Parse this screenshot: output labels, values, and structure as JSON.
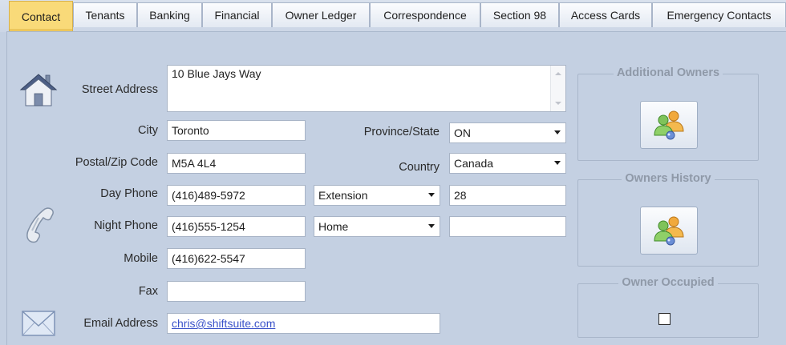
{
  "tabs": [
    {
      "label": "Contact",
      "active": true
    },
    {
      "label": "Tenants",
      "active": false
    },
    {
      "label": "Banking",
      "active": false
    },
    {
      "label": "Financial",
      "active": false
    },
    {
      "label": "Owner Ledger",
      "active": false
    },
    {
      "label": "Correspondence",
      "active": false
    },
    {
      "label": "Section 98",
      "active": false
    },
    {
      "label": "Access Cards",
      "active": false
    },
    {
      "label": "Emergency Contacts",
      "active": false
    }
  ],
  "form": {
    "street_address": {
      "label": "Street Address",
      "value": "10 Blue Jays Way"
    },
    "city": {
      "label": "City",
      "value": "Toronto"
    },
    "province": {
      "label": "Province/State",
      "value": "ON"
    },
    "postal_code": {
      "label": "Postal/Zip Code",
      "value": "M5A 4L4"
    },
    "country": {
      "label": "Country",
      "value": "Canada"
    },
    "day_phone": {
      "label": "Day Phone",
      "value": "(416)489-5972",
      "type": "Extension",
      "extra": "28"
    },
    "night_phone": {
      "label": "Night Phone",
      "value": "(416)555-1254",
      "type": "Home",
      "extra": ""
    },
    "mobile": {
      "label": "Mobile",
      "value": "(416)622-5547"
    },
    "fax": {
      "label": "Fax",
      "value": ""
    },
    "email": {
      "label": "Email Address",
      "value": "chris@shiftsuite.com"
    }
  },
  "side": {
    "additional_owners": {
      "title": "Additional Owners"
    },
    "owners_history": {
      "title": "Owners History"
    },
    "owner_occupied": {
      "title": "Owner Occupied",
      "checked": false
    }
  },
  "icons": {
    "house": "house-icon",
    "phone": "phone-handset-icon",
    "mail": "envelope-icon",
    "owners": "people-group-icon"
  },
  "colors": {
    "background": "#c4d0e2",
    "active_tab": "#f9da79",
    "link": "#3a52c9"
  }
}
